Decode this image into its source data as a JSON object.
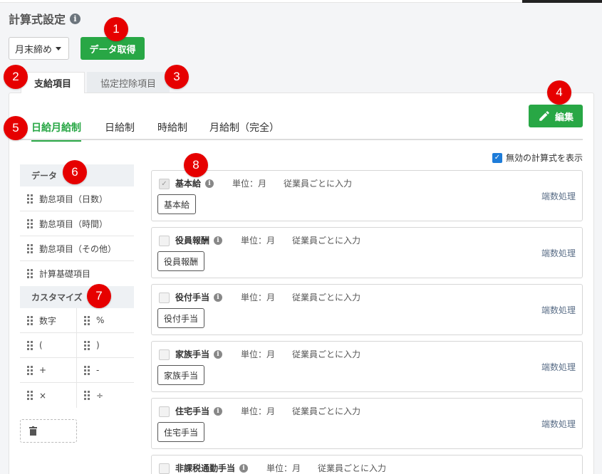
{
  "page": {
    "title": "計算式設定"
  },
  "toolbar": {
    "closing_select": "月末締め",
    "fetch_label": "データ取得",
    "edit_label": "編集"
  },
  "main_tabs": [
    {
      "label": "支給項目",
      "active": true
    },
    {
      "label": "協定控除項目",
      "active": false
    }
  ],
  "sub_tabs": [
    {
      "label": "日給月給制",
      "active": true
    },
    {
      "label": "日給制",
      "active": false
    },
    {
      "label": "時給制",
      "active": false
    },
    {
      "label": "月給制（完全）",
      "active": false
    }
  ],
  "sidebar": {
    "data_heading": "データ",
    "data_items": [
      "勤怠項目（日数）",
      "勤怠項目（時間）",
      "勤怠項目（その他）",
      "計算基礎項目"
    ],
    "custom_heading": "カスタマイズ",
    "operators": [
      "数字",
      "%",
      "(",
      ")",
      "+",
      "-",
      "×",
      "÷"
    ]
  },
  "show_invalid_label": "無効の計算式を表示",
  "formulas": [
    {
      "name": "基本給",
      "unit": "単位：月",
      "input": "従業員ごとに入力",
      "tag": "基本給",
      "rounding": "端数処理",
      "checked": true
    },
    {
      "name": "役員報酬",
      "unit": "単位：月",
      "input": "従業員ごとに入力",
      "tag": "役員報酬",
      "rounding": "端数処理",
      "checked": false
    },
    {
      "name": "役付手当",
      "unit": "単位：月",
      "input": "従業員ごとに入力",
      "tag": "役付手当",
      "rounding": "端数処理",
      "checked": false
    },
    {
      "name": "家族手当",
      "unit": "単位：月",
      "input": "従業員ごとに入力",
      "tag": "家族手当",
      "rounding": "端数処理",
      "checked": false
    },
    {
      "name": "住宅手当",
      "unit": "単位：月",
      "input": "従業員ごとに入力",
      "tag": "住宅手当",
      "rounding": "端数処理",
      "checked": false
    },
    {
      "name": "非課税通勤手当",
      "unit": "単位：月",
      "input": "従業員ごとに入力",
      "tag": "",
      "rounding": "",
      "checked": false
    }
  ],
  "annotations": [
    "1",
    "2",
    "3",
    "4",
    "5",
    "6",
    "7",
    "8"
  ],
  "colors": {
    "primary_green": "#28a745",
    "badge_red": "#e60000",
    "checkbox_blue": "#1e7cd9"
  }
}
